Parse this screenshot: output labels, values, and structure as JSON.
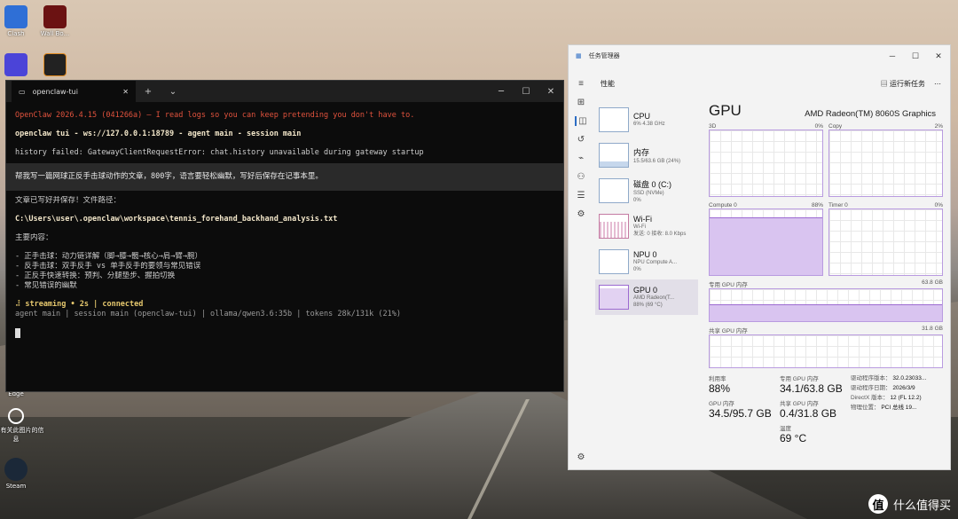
{
  "desktop": {
    "icons": [
      {
        "label": "Clash",
        "icon": "clash-icon"
      },
      {
        "label": "Wall Bo...",
        "icon": "game-icon"
      },
      {
        "label": "",
        "icon": "app-icon"
      },
      {
        "label": "",
        "icon": "app-icon-2"
      },
      {
        "label": "Edge",
        "icon": "edge-icon"
      },
      {
        "label": "了解有关此图片的信息",
        "icon": "info-icon"
      },
      {
        "label": "Steam",
        "icon": "steam-icon"
      }
    ]
  },
  "terminal": {
    "tab_title": "openclaw-tui",
    "new_tab": "+",
    "dropdown": "⌄",
    "lines": {
      "banner": "OpenClaw 2026.4.15 (041266a) — I read logs so you can keep pretending you don't have to.",
      "connection": "openclaw tui - ws://127.0.0.1:18789 - agent main - session main",
      "history_error": "history failed: GatewayClientRequestError: chat.history unavailable during gateway startup",
      "user_prompt": "帮我写一篇网球正反手击球动作的文章，800字，语言要轻松幽默，写好后保存在记事本里。",
      "saved": "文章已写好并保存！文件路径：",
      "path": "C:\\Users\\user\\.openclaw\\workspace\\tennis_forehand_backhand_analysis.txt",
      "summary_title": "主要内容：",
      "bullet1": "- 正手击球：动力链详解（脚→膝→髋→核心→肩→臂→腕）",
      "bullet2": "- 反手击球：双手反手 vs 单手反手的要领与常见错误",
      "bullet3": "- 正反手快速转换：预判、分腿垫步、握拍切换",
      "bullet4": "- 常见错误的幽默",
      "status": "⠼ streaming • 2s | connected",
      "footer": "agent main | session main (openclaw-tui) | ollama/qwen3.6:35b | tokens 28k/131k (21%)"
    }
  },
  "taskmanager": {
    "window_title": "任务管理器",
    "section": "性能",
    "run_task": "运行新任务",
    "more": "⋯",
    "items": [
      {
        "name": "CPU",
        "sub1": "6% 4.38 GHz",
        "sub2": ""
      },
      {
        "name": "内存",
        "sub1": "15.5/63.6 GB (24%)",
        "sub2": ""
      },
      {
        "name": "磁盘 0 (C:)",
        "sub1": "SSD (NVMe)",
        "sub2": "0%"
      },
      {
        "name": "Wi-Fi",
        "sub1": "Wi-Fi",
        "sub2": "发送: 0 接收: 8.0 Kbps"
      },
      {
        "name": "NPU 0",
        "sub1": "NPU Compute A...",
        "sub2": "0%"
      },
      {
        "name": "GPU 0",
        "sub1": "AMD Radeon(T...",
        "sub2": "88% (69 °C)"
      }
    ],
    "gpu": {
      "title": "GPU",
      "model": "AMD Radeon(TM) 8060S Graphics",
      "g1_label": "3D",
      "g1_val": "0%",
      "g2_label": "Copy",
      "g2_val": "2%",
      "g3_label": "Compute 0",
      "g3_val": "88%",
      "g4_label": "Timer 0",
      "g4_val": "0%",
      "ded_label": "专用 GPU 内存",
      "ded_val": "63.8 GB",
      "shared_label": "共享 GPU 内存",
      "shared_val": "31.8 GB",
      "util_label": "利用率",
      "util": "88%",
      "dmem_label": "专用 GPU 内存",
      "dmem": "34.1/63.8 GB",
      "gmem_label": "GPU 内存",
      "gmem": "34.5/95.7 GB",
      "smem_label": "共享 GPU 内存",
      "smem": "0.4/31.8 GB",
      "temp_label": "温度",
      "temp": "69 °C",
      "drv_ver_label": "驱动程序版本：",
      "drv_ver": "32.0.23033...",
      "drv_date_label": "驱动程序日期：",
      "drv_date": "2026/3/9",
      "dx_label": "DirectX 版本：",
      "dx": "12 (FL 12.2)",
      "loc_label": "物理位置：",
      "loc": "PCI 总线 19..."
    },
    "compute_usage": 0.88,
    "ded_usage": 0.53
  },
  "watermark": "什么值得买"
}
